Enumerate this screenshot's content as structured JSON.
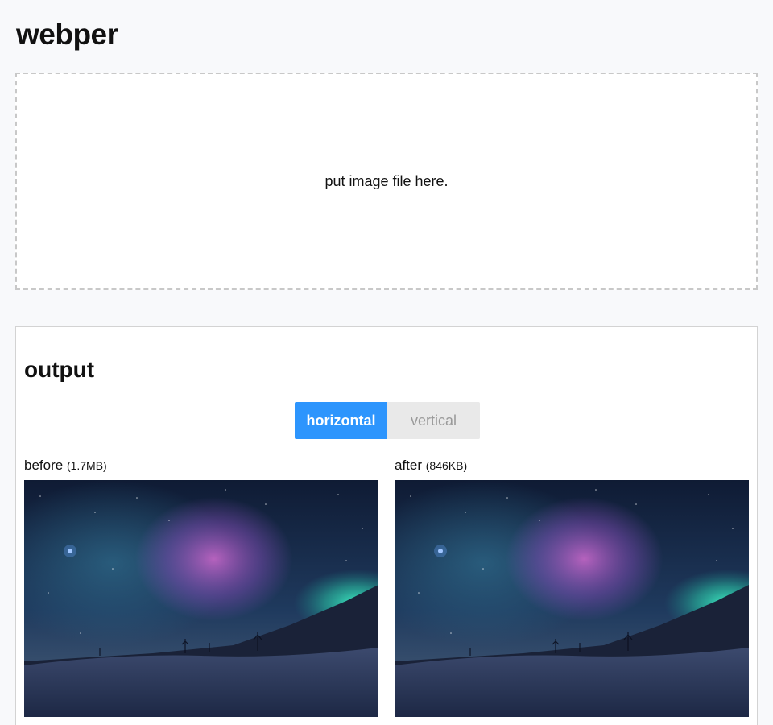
{
  "app": {
    "title": "webper"
  },
  "dropzone": {
    "text": "put image file here."
  },
  "output": {
    "title": "output",
    "toggle": {
      "active": "horizontal",
      "inactive": "vertical"
    },
    "before": {
      "label": "before",
      "size": "(1.7MB)"
    },
    "after": {
      "label": "after",
      "size": "(846KB)"
    }
  },
  "colors": {
    "accent": "#2d95fd",
    "page_bg": "#f8f9fb",
    "toggle_inactive_bg": "#e9e9e9",
    "toggle_inactive_text": "#9a9a9a"
  }
}
